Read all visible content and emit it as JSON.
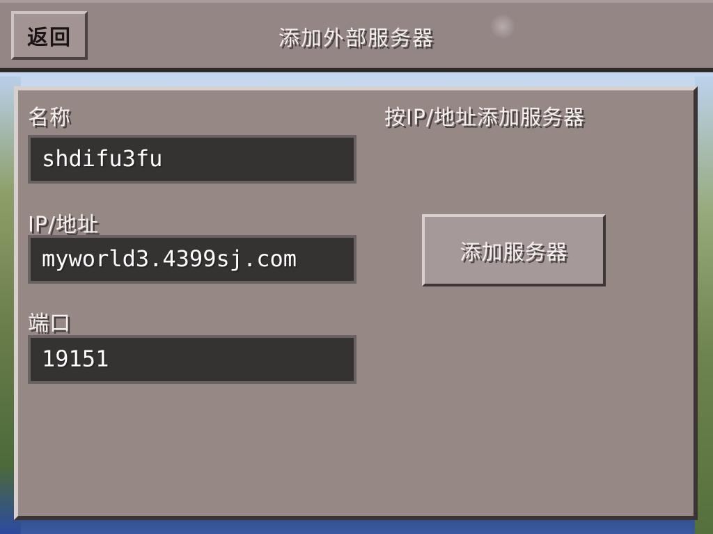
{
  "header": {
    "back_label": "返回",
    "title": "添加外部服务器"
  },
  "form": {
    "name_label": "名称",
    "name_value": "shdifu3fu",
    "ip_label": "IP/地址",
    "ip_value": "myworld3.4399sj.com",
    "port_label": "端口",
    "port_value": "19151"
  },
  "side": {
    "heading": "按IP/地址添加服务器",
    "add_button_label": "添加服务器"
  }
}
